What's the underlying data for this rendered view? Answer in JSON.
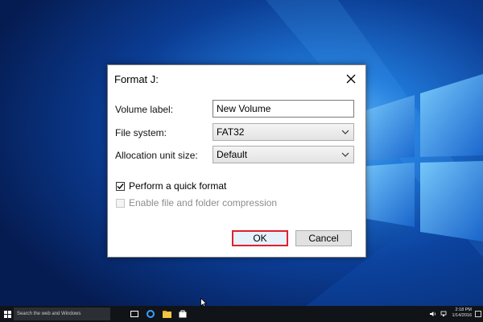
{
  "dialog": {
    "title": "Format J:",
    "volume_label": {
      "label": "Volume label:",
      "value": "New Volume"
    },
    "file_system": {
      "label": "File system:",
      "value": "FAT32"
    },
    "allocation_unit": {
      "label": "Allocation unit size:",
      "value": "Default"
    },
    "quick_format": {
      "label": "Perform a quick format",
      "checked": true,
      "enabled": true
    },
    "compression": {
      "label": "Enable file and folder compression",
      "checked": false,
      "enabled": false
    },
    "ok_label": "OK",
    "cancel_label": "Cancel"
  },
  "taskbar": {
    "search_placeholder": "Search the web and Windows",
    "time": "2:18 PM",
    "date": "1/14/2016",
    "icons": [
      "start-icon",
      "task-view-icon",
      "edge-icon",
      "file-explorer-icon",
      "store-icon",
      "volume-icon",
      "network-icon",
      "notifications-icon"
    ]
  },
  "colors": {
    "desktop_dark": "#082a6e",
    "desktop_light": "#2c8df0",
    "ok_highlight": "#e0202c",
    "taskbar": "#101418"
  }
}
